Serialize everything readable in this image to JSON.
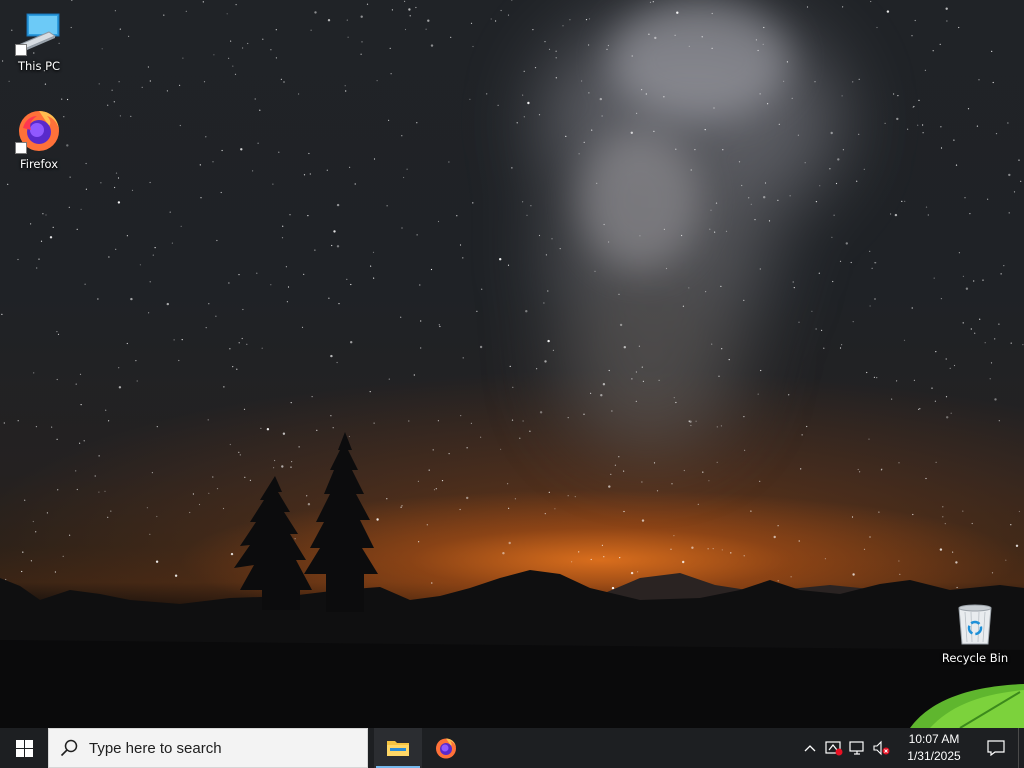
{
  "desktop": {
    "icons": [
      {
        "label": "This PC",
        "icon": "computer-icon"
      },
      {
        "label": "Firefox",
        "icon": "firefox-icon"
      },
      {
        "label": "Recycle Bin",
        "icon": "recycle-bin-icon"
      }
    ]
  },
  "taskbar": {
    "start_icon": "windows-logo-icon",
    "search": {
      "placeholder": "Type here to search",
      "icon": "search-icon"
    },
    "pinned": [
      {
        "name": "File Explorer",
        "icon": "folder-icon",
        "active": true
      },
      {
        "name": "Firefox",
        "icon": "firefox-icon",
        "active": false
      }
    ],
    "tray": {
      "icons": [
        "chevron-up-icon",
        "network-error-icon",
        "display-icon",
        "volume-muted-icon"
      ],
      "time": "10:07 AM",
      "date": "1/31/2025",
      "notification_icon": "action-center-icon"
    }
  },
  "colors": {
    "taskbar_bg": "#1d1f22",
    "accent_blue": "#76b9ed",
    "sky_glow": "#ee781e"
  }
}
